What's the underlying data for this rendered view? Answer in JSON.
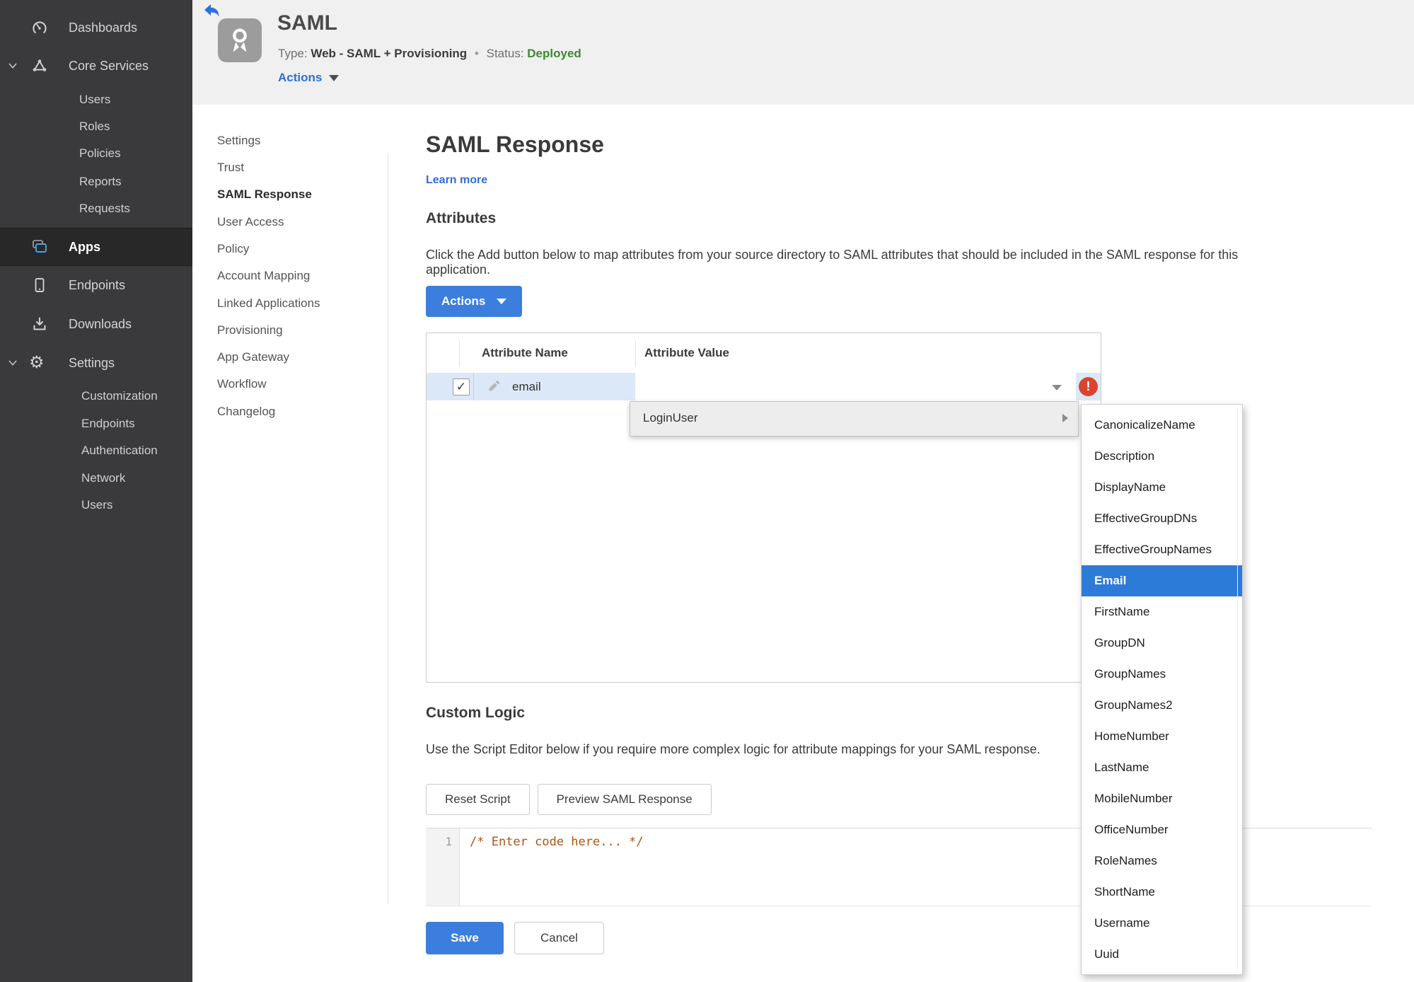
{
  "colors": {
    "accent_blue": "#2e6fdb",
    "button_blue": "#3b7edd",
    "menu_selection_blue": "#2d7bd8",
    "status_green": "#3c8a2d",
    "error_red": "#d9452c",
    "row_highlight_blue": "#dbe8f7",
    "sidebar_bg": "#3a3a3c",
    "code_comment_orange": "#ab5413"
  },
  "sidebar": {
    "items": [
      {
        "label": "Dashboards",
        "icon": "gauge-icon"
      },
      {
        "label": "Core Services",
        "icon": "core-services-icon"
      },
      {
        "label": "Users"
      },
      {
        "label": "Roles"
      },
      {
        "label": "Policies"
      },
      {
        "label": "Reports"
      },
      {
        "label": "Requests"
      },
      {
        "label": "Apps",
        "icon": "apps-icon",
        "active": true
      },
      {
        "label": "Endpoints",
        "icon": "tablet-icon"
      },
      {
        "label": "Downloads",
        "icon": "download-icon"
      },
      {
        "label": "Settings",
        "icon": "gear-icon"
      },
      {
        "label": "Customization"
      },
      {
        "label": "Endpoints"
      },
      {
        "label": "Authentication"
      },
      {
        "label": "Network"
      },
      {
        "label": "Users"
      }
    ]
  },
  "header": {
    "app_title": "SAML",
    "type_label": "Type:",
    "type_value": "Web - SAML + Provisioning",
    "separator": "•",
    "status_label": "Status:",
    "status_value": "Deployed",
    "actions_label": "Actions",
    "app_icon": "certificate-icon",
    "back_icon": "back-arrow-icon"
  },
  "subnav": {
    "items": [
      "Settings",
      "Trust",
      "SAML Response",
      "User Access",
      "Policy",
      "Account Mapping",
      "Linked Applications",
      "Provisioning",
      "App Gateway",
      "Workflow",
      "Changelog"
    ],
    "active": "SAML Response"
  },
  "main": {
    "title": "SAML Response",
    "learn_more": "Learn more",
    "attributes": {
      "heading": "Attributes",
      "description": "Click the Add button below to map attributes from your source directory to SAML attributes that should be included in the SAML response for this application.",
      "actions_button": "Actions"
    },
    "table": {
      "columns": [
        "Attribute Name",
        "Attribute Value"
      ],
      "row": {
        "checked": "✓",
        "name": "email",
        "value": "",
        "error": "!"
      }
    },
    "value_menu": {
      "trigger": "LoginUser",
      "selected": "Email",
      "options": [
        "CanonicalizeName",
        "Description",
        "DisplayName",
        "EffectiveGroupDNs",
        "EffectiveGroupNames",
        "Email",
        "FirstName",
        "GroupDN",
        "GroupNames",
        "GroupNames2",
        "HomeNumber",
        "LastName",
        "MobileNumber",
        "OfficeNumber",
        "RoleNames",
        "ShortName",
        "Username",
        "Uuid"
      ]
    },
    "custom_logic": {
      "heading": "Custom Logic",
      "description": "Use the Script Editor below if you require more complex logic for attribute mappings for your SAML response.",
      "reset_button": "Reset Script",
      "preview_button": "Preview SAML Response",
      "editor": {
        "line_number": "1",
        "code": "/* Enter code here... */"
      }
    },
    "footer": {
      "save": "Save",
      "cancel": "Cancel"
    }
  }
}
